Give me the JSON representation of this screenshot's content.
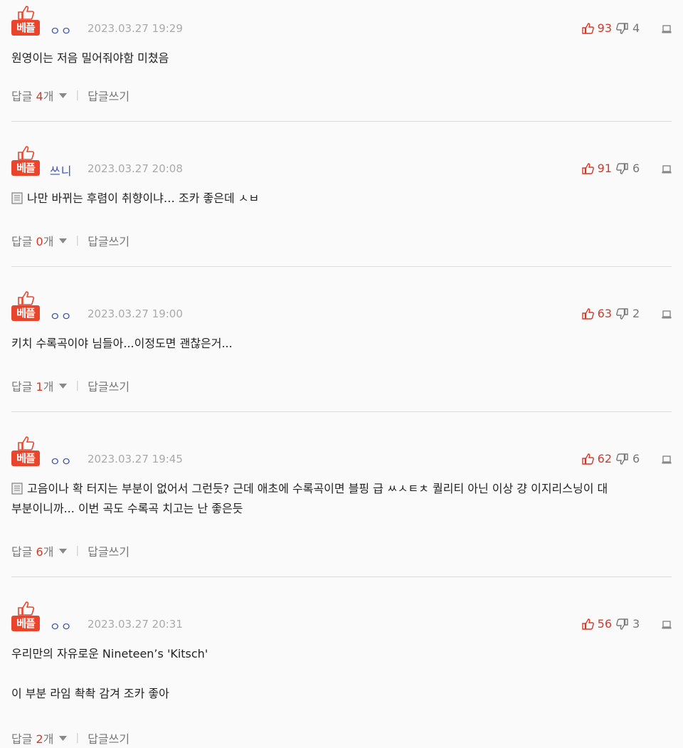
{
  "labels": {
    "best": "베플",
    "reply": "답글",
    "count_suffix": "개",
    "write_reply": "답글쓰기"
  },
  "colors": {
    "accent": "#e8452c",
    "like": "#d43a2a",
    "nick": "#3a4fb0"
  },
  "comments": [
    {
      "nick": "ㅇㅇ",
      "date": "2023.03.27 19:29",
      "likes": "93",
      "dislikes": "4",
      "has_image": false,
      "lines": [
        "원영이는 저음 밀어줘야함 미쳤음"
      ],
      "reply_count": "4"
    },
    {
      "nick": "쓰니",
      "date": "2023.03.27 20:08",
      "likes": "91",
      "dislikes": "6",
      "has_image": true,
      "lines": [
        "나만 바뀌는 후렴이 취향이냐… 조카 좋은데 ㅅㅂ"
      ],
      "reply_count": "0"
    },
    {
      "nick": "ㅇㅇ",
      "date": "2023.03.27 19:00",
      "likes": "63",
      "dislikes": "2",
      "has_image": false,
      "lines": [
        "키치 수록곡이야 님들아...이정도면 괜찮은거..."
      ],
      "reply_count": "1"
    },
    {
      "nick": "ㅇㅇ",
      "date": "2023.03.27 19:45",
      "likes": "62",
      "dislikes": "6",
      "has_image": true,
      "lines": [
        "고음이나 확 터지는 부분이 없어서 그런듯? 근데 애초에 수록곡이면 블핑 급 ㅆㅅㅌㅊ 퀄리티 아닌 이상 걍 이지리스닝이 대",
        "부분이니까... 이번 곡도 수록곡 치고는 난 좋은듯"
      ],
      "reply_count": "6"
    },
    {
      "nick": "ㅇㅇ",
      "date": "2023.03.27 20:31",
      "likes": "56",
      "dislikes": "3",
      "has_image": false,
      "lines": [
        "우리만의 자유로운 Nineteen’s 'Kitsch'",
        "",
        "이 부분 라임 촥촥 감겨 조카 좋아"
      ],
      "reply_count": "2"
    }
  ]
}
